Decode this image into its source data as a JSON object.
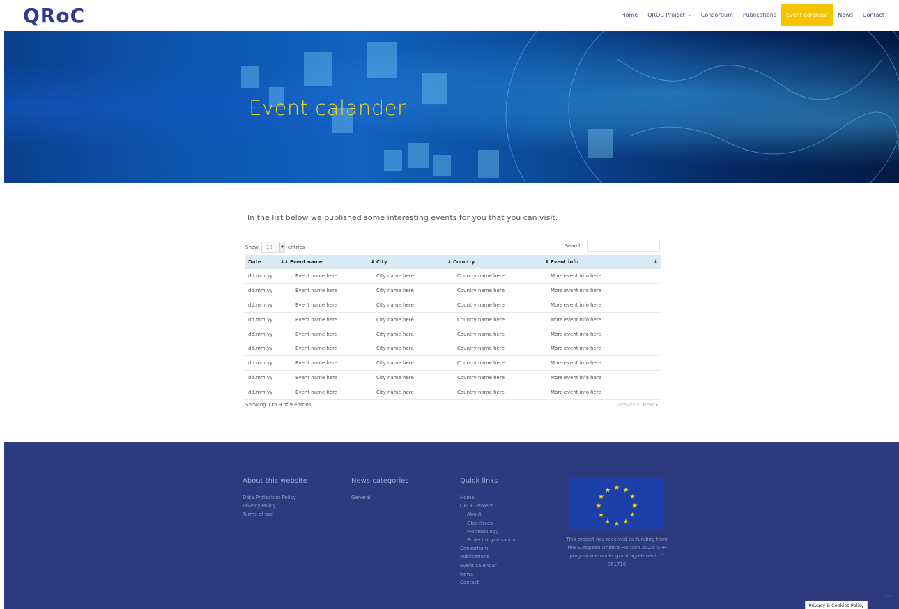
{
  "header": {
    "logo": "QRoC",
    "nav": [
      {
        "label": "Home",
        "active": false
      },
      {
        "label": "QROC Project",
        "active": false,
        "has_dropdown": true
      },
      {
        "label": "Consortium",
        "active": false
      },
      {
        "label": "Publications",
        "active": false
      },
      {
        "label": "Event calendar",
        "active": true
      },
      {
        "label": "News",
        "active": false
      },
      {
        "label": "Contact",
        "active": false
      }
    ],
    "accent_color": "#f5c400"
  },
  "hero": {
    "title": "Event calander"
  },
  "intro": "In the list below we published some interesting events for you that you can visit.",
  "table_controls": {
    "show_label": "Show",
    "page_length": "10",
    "entries_label": "entries",
    "search_label": "Search:"
  },
  "table": {
    "columns": [
      "Date",
      "Event name",
      "City",
      "Country",
      "Event info"
    ],
    "rows": [
      [
        "dd.mm.yy",
        "Event name here",
        "City name here",
        "Country name here",
        "More event info here"
      ],
      [
        "dd.mm.yy",
        "Event name here",
        "City name here",
        "Country name here",
        "More event info here"
      ],
      [
        "dd.mm.yy",
        "Event name here",
        "City name here",
        "Country name here",
        "More event info here"
      ],
      [
        "dd.mm.yy",
        "Event name here",
        "City name here",
        "Country name here",
        "More event info here"
      ],
      [
        "dd.mm.yy",
        "Event name here",
        "City name here",
        "Country name here",
        "More event info here"
      ],
      [
        "dd.mm.yy",
        "Event name here",
        "City name here",
        "Country name here",
        "More event info here"
      ],
      [
        "dd.mm.yy",
        "Event name here",
        "City name here",
        "Country name here",
        "More event info here"
      ],
      [
        "dd.mm.yy",
        "Event name here",
        "City name here",
        "Country name here",
        "More event info here"
      ],
      [
        "dd.mm.yy",
        "Event name here",
        "City name here",
        "Country name here",
        "More event info here"
      ]
    ],
    "header_color": "#d9eaf5"
  },
  "table_footer": {
    "info": "Showing 1 to 9 of 9 entries",
    "previous": "Previous",
    "next": "Next"
  },
  "footer": {
    "about": {
      "title": "About this website",
      "links": [
        "Data Protection Policy",
        "Privacy Policy",
        "Terms of use"
      ]
    },
    "news": {
      "title": "News categories",
      "links": [
        "General"
      ]
    },
    "quick": {
      "title": "Quick links",
      "links": [
        {
          "label": "Home",
          "sub": false
        },
        {
          "label": "QROC Project",
          "sub": false
        },
        {
          "label": "About",
          "sub": true
        },
        {
          "label": "Objectives",
          "sub": true
        },
        {
          "label": "Methodology",
          "sub": true
        },
        {
          "label": "Project organisation",
          "sub": true
        },
        {
          "label": "Consortium",
          "sub": false
        },
        {
          "label": "Publications",
          "sub": false
        },
        {
          "label": "Event calendar",
          "sub": false
        },
        {
          "label": "News",
          "sub": false
        },
        {
          "label": "Contact",
          "sub": false
        }
      ]
    },
    "eu_text": "This project has received co-funding from the European Union's Horizon 2020 ISFP programme under grant agreement n° 861716",
    "background": "#2d3b7e"
  },
  "cookie_label": "Privacy & Cookies Policy"
}
